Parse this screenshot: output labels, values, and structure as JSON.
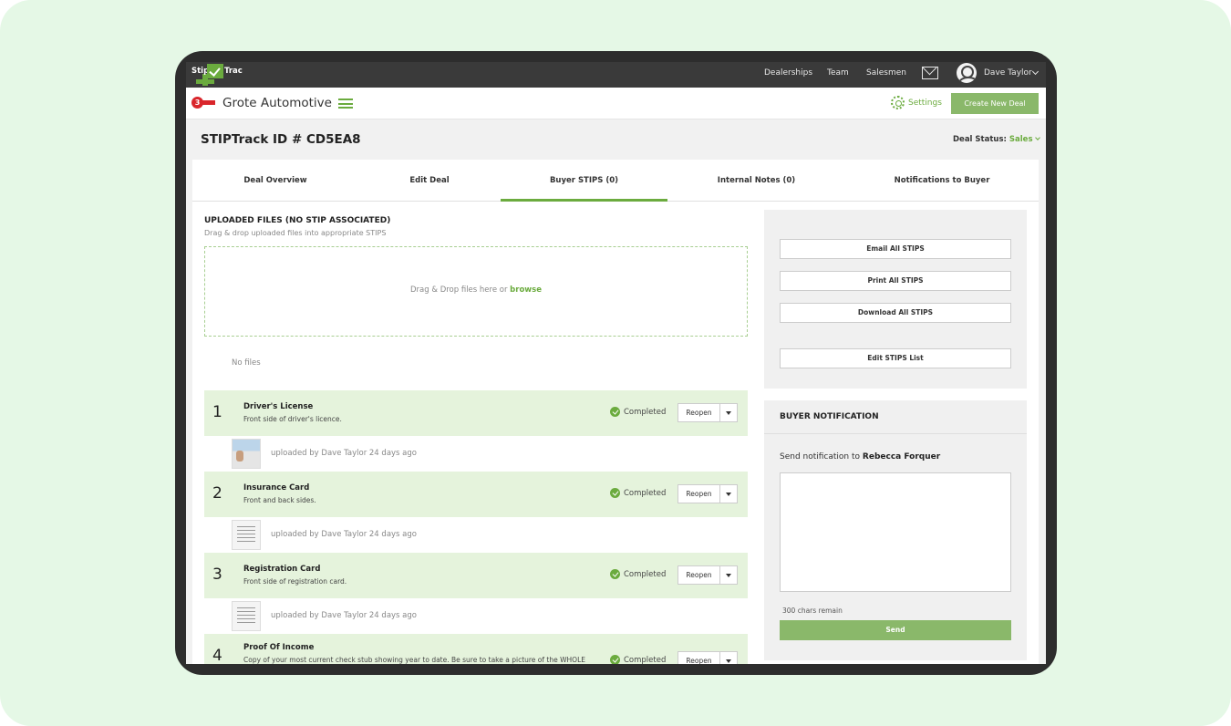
{
  "topnav": {
    "logo_left": "Stip",
    "logo_right": "Trac",
    "links": [
      "Dealerships",
      "Team",
      "Salesmen"
    ],
    "user_name": "Dave Taylor"
  },
  "header": {
    "dealer_logo_text": "3",
    "dealer_name": "Grote Automotive",
    "settings_label": "Settings",
    "create_button": "Create New Deal"
  },
  "page": {
    "title": "STIPTrack ID # CD5EA8",
    "deal_status_label": "Deal Status:",
    "deal_status_value": "Sales"
  },
  "tabs": [
    {
      "label": "Deal Overview"
    },
    {
      "label": "Edit Deal"
    },
    {
      "label": "Buyer STIPS (0)"
    },
    {
      "label": "Internal Notes (0)"
    },
    {
      "label": "Notifications to Buyer"
    }
  ],
  "uploads": {
    "title": "UPLOADED FILES (NO STIP ASSOCIATED)",
    "subtitle": "Drag & drop uploaded files into appropriate STIPS",
    "drop_text": "Drag & Drop files here or ",
    "browse": "browse",
    "no_files": "No files"
  },
  "stips": [
    {
      "num": "1",
      "name": "Driver's License",
      "desc": "Front side of driver's licence.",
      "status": "Completed",
      "reopen": "Reopen",
      "uploaded": "uploaded by Dave Taylor 24 days ago"
    },
    {
      "num": "2",
      "name": "Insurance Card",
      "desc": "Front and back sides.",
      "status": "Completed",
      "reopen": "Reopen",
      "uploaded": "uploaded by Dave Taylor 24 days ago"
    },
    {
      "num": "3",
      "name": "Registration Card",
      "desc": "Front side of registration card.",
      "status": "Completed",
      "reopen": "Reopen",
      "uploaded": "uploaded by Dave Taylor 24 days ago"
    },
    {
      "num": "4",
      "name": "Proof Of Income",
      "desc": "Copy of your most current check stub showing year to date. Be sure to take a picture of the WHOLE",
      "status": "Completed",
      "reopen": "Reopen"
    }
  ],
  "actions": {
    "email": "Email All STIPS",
    "print": "Print All STIPS",
    "download": "Download All STIPS",
    "edit": "Edit STIPS List"
  },
  "notification": {
    "title": "BUYER NOTIFICATION",
    "send_to_label": "Send notification to ",
    "recipient": "Rebecca Forquer",
    "message": "",
    "chars_remaining": "300 chars remain",
    "send": "Send"
  },
  "colors": {
    "accent": "#6bab3e",
    "button_green": "#8ab86a",
    "stip_row": "#e5f3dc",
    "topnav": "#3a3a3a",
    "backdrop": "#e5f8e6"
  }
}
